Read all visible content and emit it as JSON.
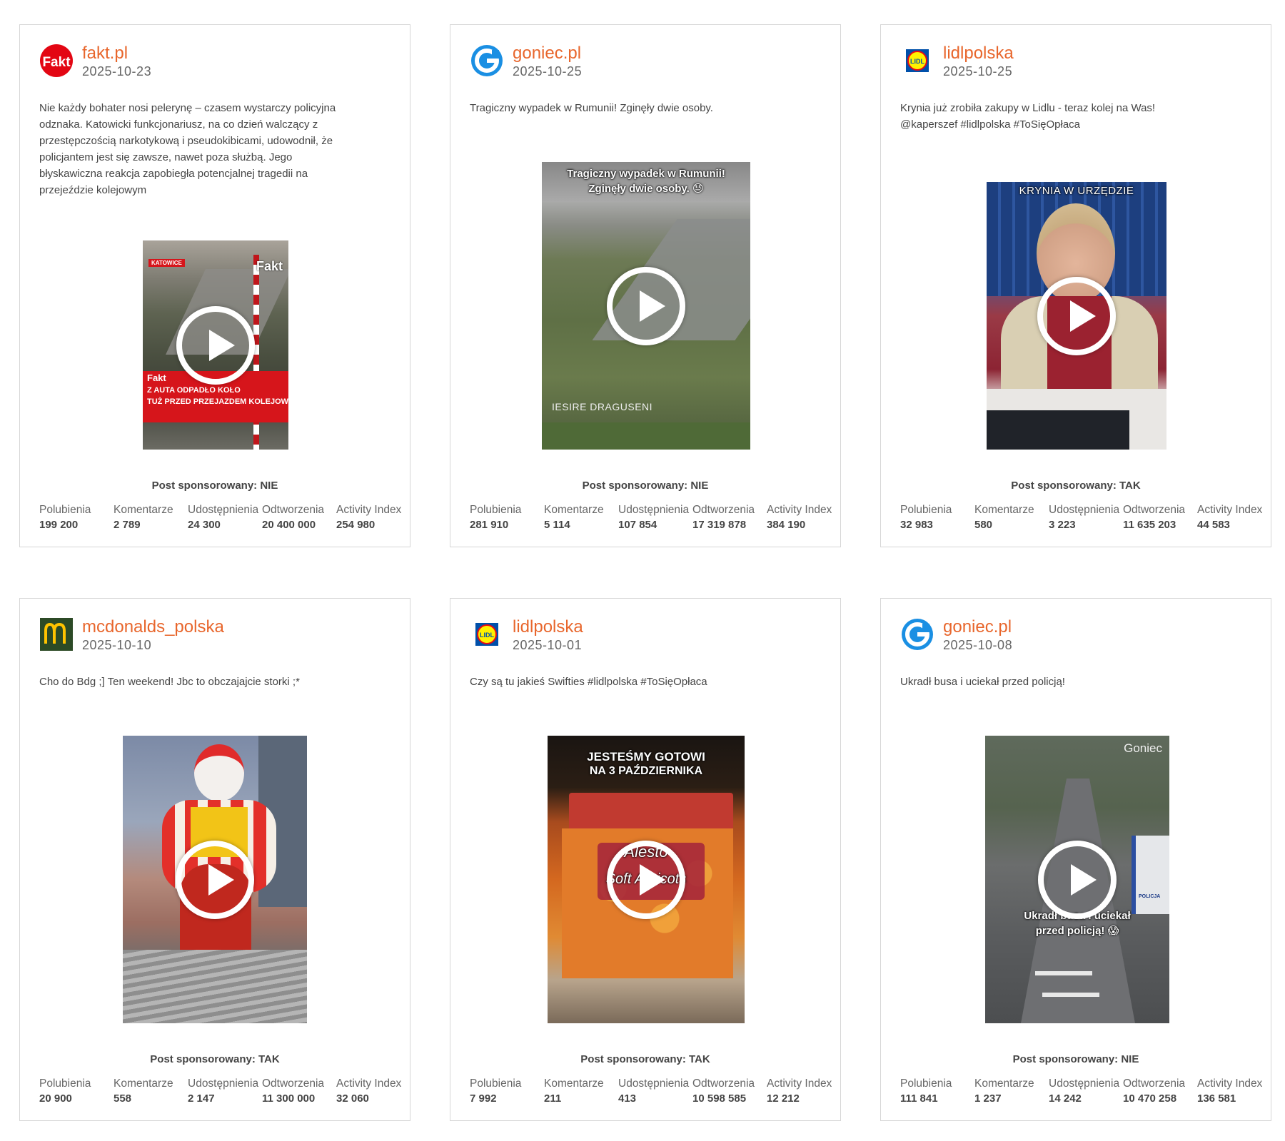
{
  "stat_labels": {
    "likes": "Polubienia",
    "comments": "Komentarze",
    "shares": "Udostępnienia",
    "views": "Odtworzenia",
    "activity": "Activity Index"
  },
  "colors": {
    "accent": "#e8662c",
    "border": "#d6d6d6"
  },
  "posts": [
    {
      "author": "fakt.pl",
      "date": "2025-10-23",
      "logo_icon": "fakt-logo",
      "description": "Nie każdy bohater nosi pelerynę – czasem wystarczy policyjna odznaka. Katowicki funkcjonariusz, na co dzień walczący z przestępczością narkotykową i pseudokibicami, udowodnił, że policjantem jest się zawsze, nawet poza służbą. Jego błyskawiczna reakcja zapobiegła potencjalnej tragedii na przejeździe kolejowym",
      "media_texts": [
        "KATOWICE",
        "Fakt",
        "Fakt",
        "Z AUTA ODPADŁO KOŁO",
        "TUŻ PRZED PRZEJAZDEM KOLEJOWYM!"
      ],
      "sponsored": "Post sponsorowany: NIE",
      "likes": "199 200",
      "comments": "2 789",
      "shares": "24 300",
      "views": "20 400 000",
      "activity": "254 980"
    },
    {
      "author": "goniec.pl",
      "date": "2025-10-25",
      "logo_icon": "goniec-logo",
      "description": "Tragiczny wypadek w Rumunii! Zginęły dwie osoby.",
      "media_texts": [
        "Tragiczny wypadek w Rumunii!",
        "Zginęły dwie osoby. 😓",
        "IESIRE DRAGUSENI"
      ],
      "sponsored": "Post sponsorowany: NIE",
      "likes": "281 910",
      "comments": "5 114",
      "shares": "107 854",
      "views": "17 319 878",
      "activity": "384 190"
    },
    {
      "author": "lidlpolska",
      "date": "2025-10-25",
      "logo_icon": "lidl-logo",
      "description": "Krynia już zrobiła zakupy w Lidlu - teraz kolej na Was! @kaperszef #lidlpolska #ToSięOpłaca",
      "media_texts": [
        "KRYNIA W URZĘDZIE"
      ],
      "sponsored": "Post sponsorowany: TAK",
      "likes": "32 983",
      "comments": "580",
      "shares": "3 223",
      "views": "11 635 203",
      "activity": "44 583"
    },
    {
      "author": "mcdonalds_polska",
      "date": "2025-10-10",
      "logo_icon": "mcdonalds-logo",
      "description": "Cho do Bdg ;] Ten weekend! Jbc to obczajajcie storki ;*",
      "media_texts": [],
      "sponsored": "Post sponsorowany: TAK",
      "likes": "20 900",
      "comments": "558",
      "shares": "2 147",
      "views": "11 300 000",
      "activity": "32 060"
    },
    {
      "author": "lidlpolska",
      "date": "2025-10-01",
      "logo_icon": "lidl-logo",
      "description": "Czy są tu jakieś Swifties #lidlpolska #ToSięOpłaca",
      "media_texts": [
        "JESTEŚMY GOTOWI",
        "NA 3 PAŹDZIERNIKA",
        "Alesto",
        "Soft Apricots"
      ],
      "sponsored": "Post sponsorowany: TAK",
      "likes": "7 992",
      "comments": "211",
      "shares": "413",
      "views": "10 598 585",
      "activity": "12 212"
    },
    {
      "author": "goniec.pl",
      "date": "2025-10-08",
      "logo_icon": "goniec-logo",
      "description": "Ukradł busa i uciekał przed policją!",
      "media_texts": [
        "Goniec",
        "Ukradł busa i uciekał",
        "przed policją! 😱",
        "POLICJA"
      ],
      "sponsored": "Post sponsorowany: NIE",
      "likes": "111 841",
      "comments": "1 237",
      "shares": "14 242",
      "views": "10 470 258",
      "activity": "136 581"
    }
  ]
}
